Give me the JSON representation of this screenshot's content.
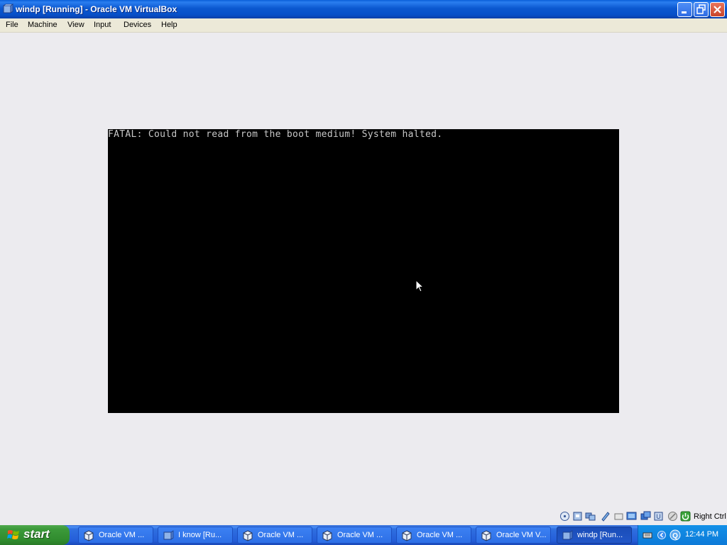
{
  "window": {
    "title": "windp [Running] - Oracle VM VirtualBox",
    "icon": "virtualbox-icon"
  },
  "title_buttons": [
    {
      "name": "minimize-button",
      "icon": "minimize-icon"
    },
    {
      "name": "restore-button",
      "icon": "restore-icon"
    },
    {
      "name": "close-button",
      "icon": "close-icon"
    }
  ],
  "menu": {
    "items": [
      {
        "label": "File"
      },
      {
        "label": "Machine"
      },
      {
        "label": "View"
      },
      {
        "label": "Input"
      },
      {
        "label": "Devices"
      },
      {
        "label": "Help"
      }
    ]
  },
  "vm_screen": {
    "message": "FATAL: Could not read from the boot medium! System halted."
  },
  "statusbar": {
    "icons": [
      "hard-disk-icon",
      "optical-drive-icon",
      "audio-icon",
      "network-icon",
      "usb-icon",
      "shared-folder-icon",
      "display-icon",
      "video-capture-icon",
      "virtualization-icon",
      "mouse-integration-icon",
      "host-key-icon"
    ],
    "host_key": "Right Ctrl"
  },
  "taskbar": {
    "start_label": "start",
    "tasks": [
      {
        "label": "Oracle VM ...",
        "icon": "virtualbox-cube-icon",
        "active": false
      },
      {
        "label": "I know [Ru...",
        "icon": "virtualbox-icon",
        "active": false
      },
      {
        "label": "Oracle VM ...",
        "icon": "virtualbox-cube-icon",
        "active": false
      },
      {
        "label": "Oracle VM ...",
        "icon": "virtualbox-cube-icon",
        "active": false
      },
      {
        "label": "Oracle VM ...",
        "icon": "virtualbox-cube-icon",
        "active": false
      },
      {
        "label": "Oracle VM V...",
        "icon": "virtualbox-cube-icon",
        "active": false
      },
      {
        "label": "windp [Run...",
        "icon": "virtualbox-icon",
        "active": true
      }
    ],
    "tray_icons": [
      "keyboard-icon",
      "chevron-left-icon",
      "quicktime-icon"
    ],
    "clock": "12:44 PM"
  },
  "colors": {
    "titlebar": "#0b58d0",
    "taskbar": "#245dd8",
    "start": "#3c9a3a",
    "vm_background": "#000000",
    "boot_text": "#c8c8c8",
    "client_background": "#ecebef"
  }
}
